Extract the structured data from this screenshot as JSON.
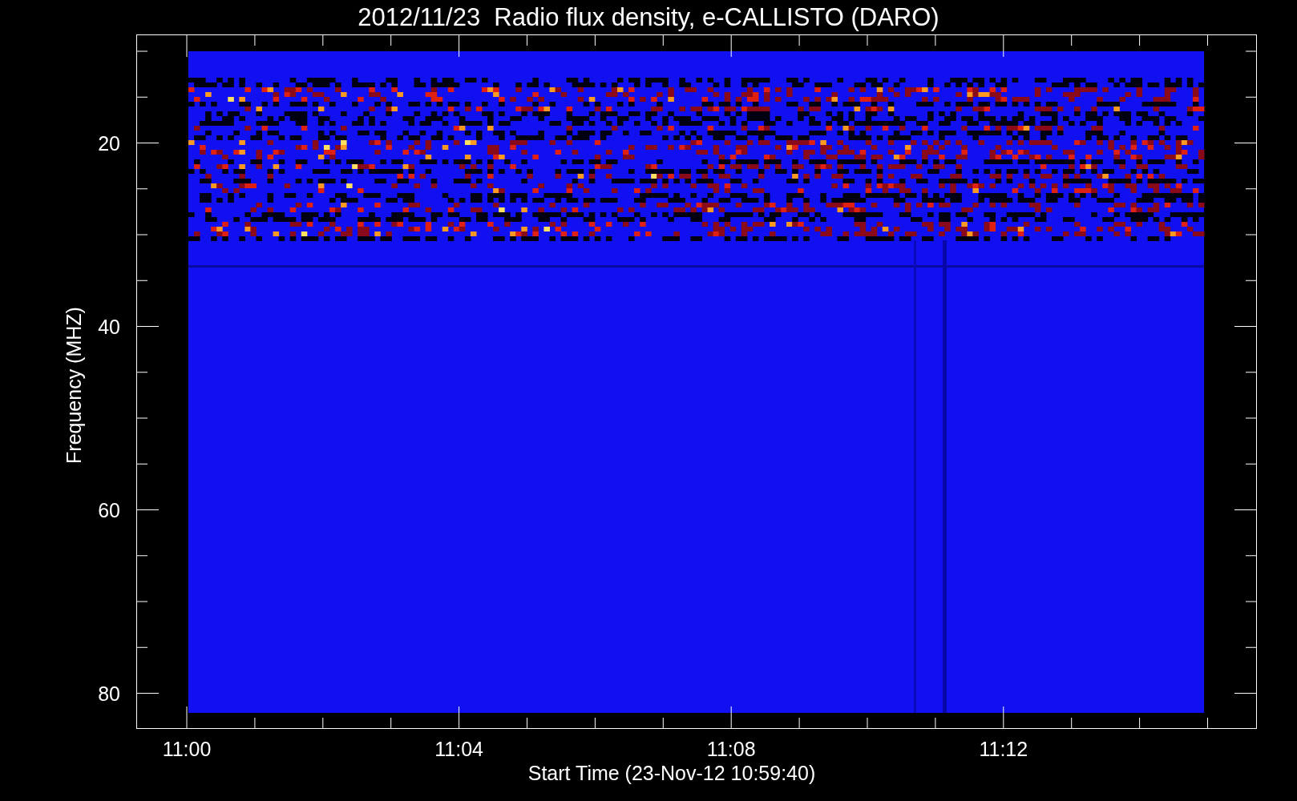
{
  "title": "2012/11/23  Radio flux density, e-CALLISTO (DARO)",
  "plot": {
    "ylabel": "Frequency (MHZ)",
    "xlabel": "Start Time (23-Nov-12 10:59:40)",
    "yticks": [
      "20",
      "40",
      "60",
      "80"
    ],
    "xticks": [
      "11:00",
      "11:04",
      "11:08",
      "11:12"
    ]
  }
}
